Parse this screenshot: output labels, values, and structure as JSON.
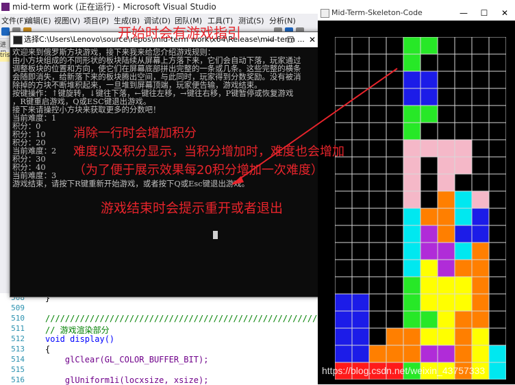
{
  "vs": {
    "title": "mid-term work (正在运行) - Microsoft Visual Studio",
    "menu": [
      "文件(F)",
      "编辑(E)",
      "视图(V)",
      "项目(P)",
      "生成(B)",
      "调试(D)",
      "团队(M)",
      "工具(T)",
      "测试(S)",
      "分析(N)"
    ],
    "side_tab_1": "进程",
    "side_tab_2": "tris",
    "code_lines": [
      {
        "num": "508",
        "text": "}"
      },
      {
        "num": "509",
        "text": ""
      },
      {
        "num": "510",
        "text": "//////////////////////////////////////////////////////////////"
      },
      {
        "num": "511",
        "text": "// 游戏渲染部分"
      },
      {
        "num": "512",
        "text": "void display()"
      },
      {
        "num": "513",
        "text": "{"
      },
      {
        "num": "514",
        "text": "    glClear(GL_COLOR_BUFFER_BIT);"
      },
      {
        "num": "515",
        "text": ""
      },
      {
        "num": "516",
        "text": "    glUniform1i(locxsize, xsize);"
      }
    ]
  },
  "console": {
    "title": "选择C:\\Users\\Lenovo\\source\\repos\\mid-term work\\x64\\Release\\mid-term ...",
    "minimize": "—",
    "maximize": "☐",
    "close": "✕",
    "lines": [
      "欢迎来到俄罗斯方块游戏，接下来我来给您介绍游戏规则：",
      "由小方块组成的不同形状的板块陆续从屏幕上方落下来，它们会自动下落，玩家通过",
      "调整板块的位置和方向，使它们在屏幕底部拼出完整的一条或几条。这些完整的横条",
      "会随即消失，给新落下来的板块腾出空间，与此同时，玩家得到分数奖励。没有被消",
      "除掉的方块不断堆积起来，一旦堆到屏幕顶端，玩家便告输，游戏结束。",
      "按键操作：↑键旋转，↓键往下落，←键往左移，→键往右移，P键暂停或恢复游戏",
      "，R键重启游戏，Q或ESC键退出游戏。",
      "接下来请操控小方块来获取更多的分数吧！",
      "当前难度：1",
      "积分：0",
      "积分：10",
      "积分：20",
      "当前难度：2",
      "积分：30",
      "积分：40",
      "当前难度：3",
      "游戏结束，请按下R键重新开始游戏，或者按下Q或Esc键退出游戏。"
    ]
  },
  "game": {
    "title": "Mid-Term-Skeleton-Code",
    "minimize": "—",
    "maximize": "☐",
    "close": "✕",
    "board_cols": 10,
    "board_rows": 20,
    "grid": [
      "....GG....",
      "....G.....",
      "....BB....",
      "....BB....",
      "....GG....",
      "....G.....",
      "....PPPP..",
      "....P.PP..",
      "....P.P...",
      "....P.OCP.",
      "....COOCB.",
      "....CMOBB.",
      "....CMMCO.",
      "....CYMOO.",
      "....GYYYO.",
      "BB..GYYYO.",
      "BB..GGYOO.",
      "BB.OOYYOY.",
      "BBOOOMMOYC",
      "RRRRGYYOYC"
    ],
    "colors": {
      "G": "#27e827",
      "B": "#1c1ce8",
      "P": "#f5b8c8",
      "O": "#ff7f00",
      "C": "#00e8f0",
      "M": "#b02cd8",
      "Y": "#ffff00",
      "R": "#ff1a1a"
    }
  },
  "annotations": {
    "start_hint": "开始时会有游戏指引",
    "score_hint": "消除一行时会增加积分",
    "difficulty_hint": "难度以及积分显示，当积分增加时，难度也会增加",
    "interval_hint": "（为了便于展示效果每20积分增加一次难度）",
    "gameover_hint": "游戏结束时会提示重开或者退出",
    "color": "#e8242b"
  },
  "watermark": "https://blog.csdn.net/weixin_43757333"
}
